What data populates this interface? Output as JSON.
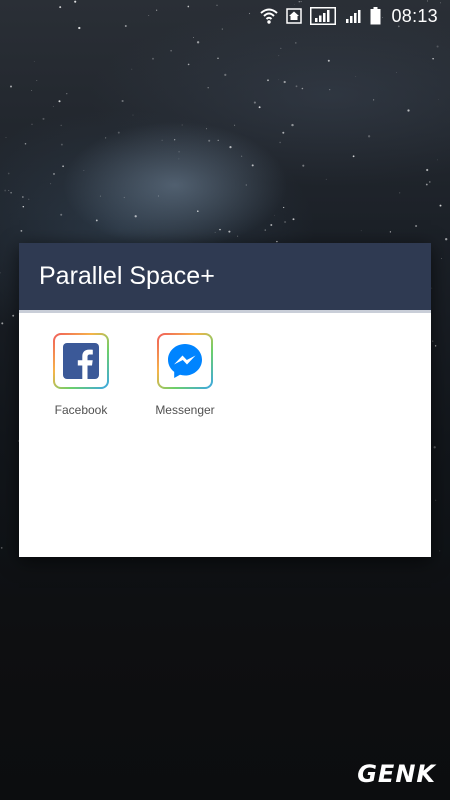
{
  "status_bar": {
    "time": "08:13",
    "icons": [
      "wifi-icon",
      "home-icon",
      "signal-box-icon",
      "signal-icon",
      "battery-icon"
    ]
  },
  "dialog": {
    "title": "Parallel Space+",
    "header_color": "#2f3a52",
    "apps": [
      {
        "label": "Facebook",
        "icon": "facebook-icon",
        "color": "#3b5998"
      },
      {
        "label": "Messenger",
        "icon": "messenger-icon",
        "color": "#0084ff"
      }
    ]
  },
  "watermark": "GENK"
}
